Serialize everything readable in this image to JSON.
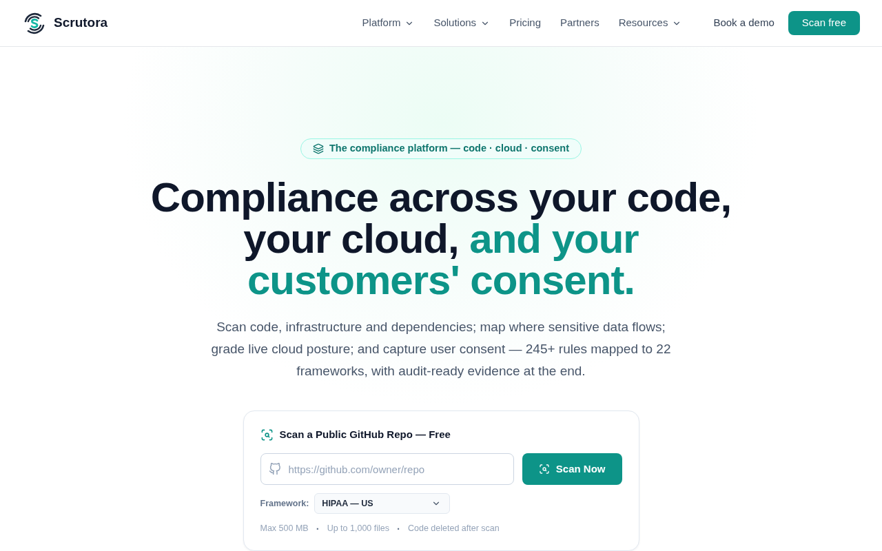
{
  "header": {
    "brand": "Scrutora",
    "nav": [
      {
        "label": "Platform",
        "has_menu": true
      },
      {
        "label": "Solutions",
        "has_menu": true
      },
      {
        "label": "Pricing",
        "has_menu": false
      },
      {
        "label": "Partners",
        "has_menu": false
      },
      {
        "label": "Resources",
        "has_menu": true
      }
    ],
    "actions": [
      {
        "label": "Book a demo",
        "kind": "link"
      },
      {
        "label": "Scan free",
        "kind": "primary"
      }
    ]
  },
  "hero": {
    "badge": "The compliance platform — code · cloud · consent",
    "headline": [
      [
        {
          "text": "Compliance across your code,",
          "accent": false
        }
      ],
      [
        {
          "text": "your cloud,",
          "accent": false
        },
        {
          "text": "and your",
          "accent": true
        }
      ],
      [
        {
          "text": "customers' consent.",
          "accent": true
        }
      ]
    ],
    "subtitle": "Scan code, infrastructure and dependencies; map where sensitive data flows; grade live cloud posture; and capture user consent — 245+ rules mapped to 22 frameworks, with audit-ready evidence at the end."
  },
  "scan_card": {
    "title": "Scan a Public GitHub Repo — Free",
    "repo_input": {
      "placeholder": "https://github.com/owner/repo"
    },
    "button": "Scan Now",
    "framework": {
      "label": "Framework:",
      "value": "HIPAA — US"
    },
    "notes": [
      "Max 500 MB",
      "Up to 1,000 files",
      "Code deleted after scan"
    ],
    "separator": "·"
  }
}
